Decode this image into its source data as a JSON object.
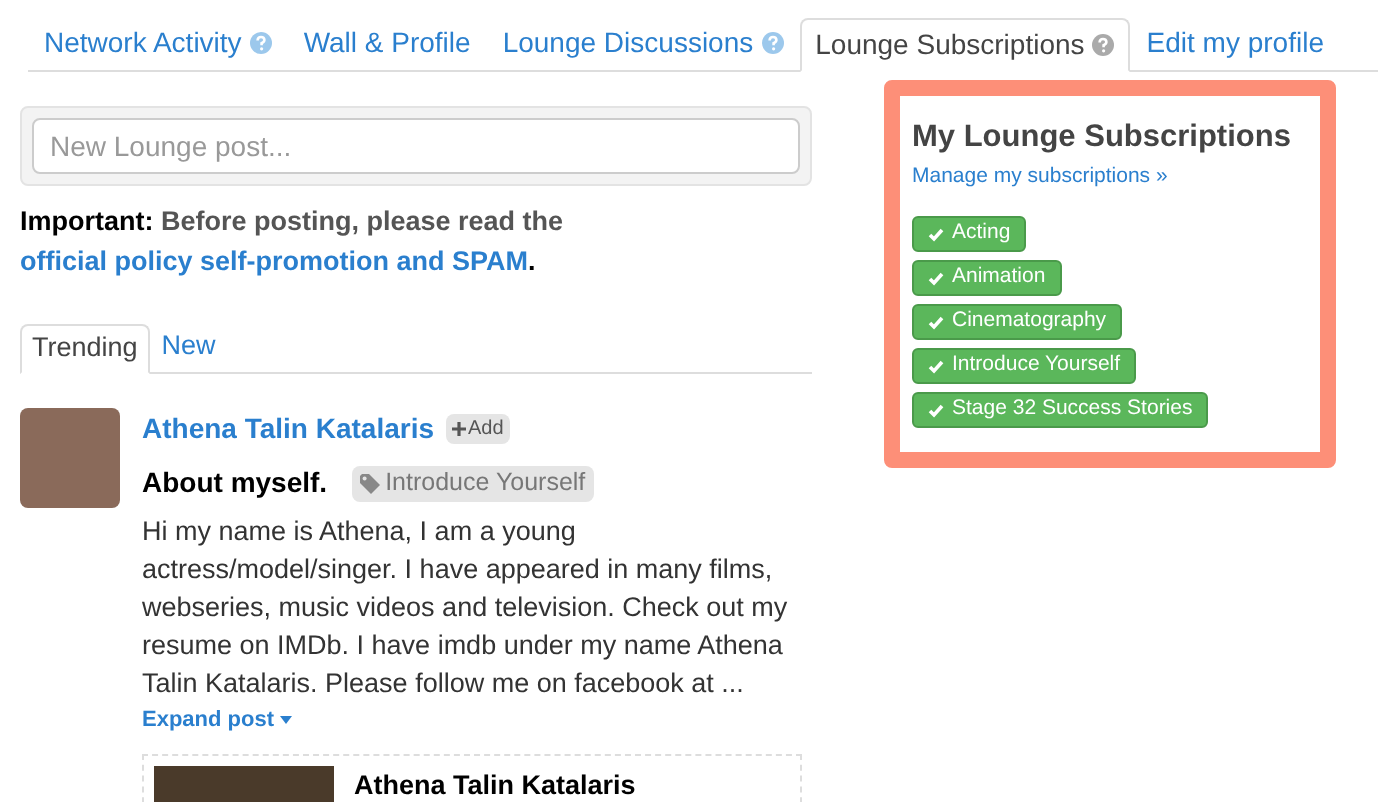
{
  "tabs": [
    {
      "label": "Network Activity",
      "help": true,
      "selected": false
    },
    {
      "label": "Wall & Profile",
      "help": false,
      "selected": false
    },
    {
      "label": "Lounge Discussions",
      "help": true,
      "selected": false
    },
    {
      "label": "Lounge Subscriptions",
      "help": true,
      "selected": true
    },
    {
      "label": "Edit my profile",
      "help": false,
      "selected": false
    }
  ],
  "composer": {
    "placeholder": "New Lounge post..."
  },
  "notice": {
    "label": "Important:",
    "text": "Before posting, please read the",
    "link": "official policy self-promotion and SPAM",
    "end": "."
  },
  "feed_tabs": [
    {
      "label": "Trending",
      "selected": true
    },
    {
      "label": "New",
      "selected": false
    }
  ],
  "post": {
    "author": "Athena Talin Katalaris",
    "add": "Add",
    "title": "About myself.",
    "tag": "Introduce Yourself",
    "body": "Hi my name is Athena, I am a young actress/model/singer. I have appeared in many films, webseries, music videos and television. Check out my resume on IMDb. I have imdb under my name Athena Talin Katalaris. Please follow me on facebook at ...",
    "expand": "Expand post",
    "preview_title": "Athena Talin Katalaris"
  },
  "subscriptions": {
    "title": "My Lounge Subscriptions",
    "manage": "Manage my subscriptions »",
    "items": [
      "Acting",
      "Animation",
      "Cinematography",
      "Introduce Yourself",
      "Stage 32 Success Stories"
    ]
  }
}
